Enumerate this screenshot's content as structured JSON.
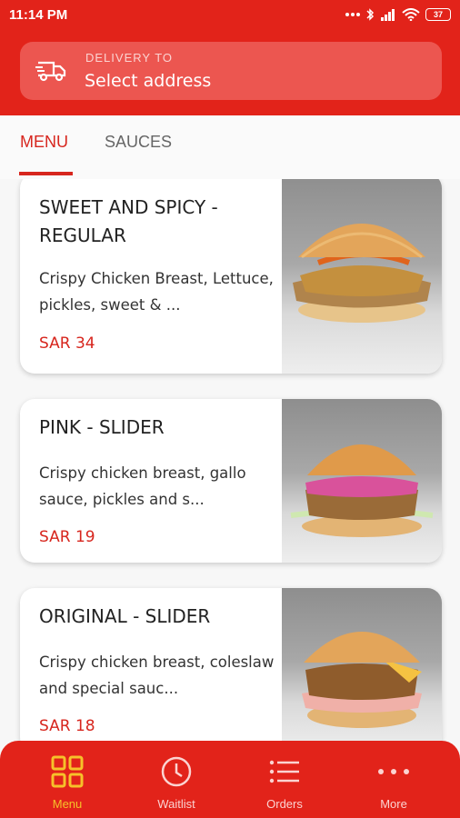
{
  "status_bar": {
    "time": "11:14 PM",
    "battery": "37"
  },
  "delivery": {
    "label": "DELIVERY TO",
    "value": "Select address"
  },
  "tabs": [
    {
      "label": "MENU",
      "active": true
    },
    {
      "label": "SAUCES",
      "active": false
    }
  ],
  "items": [
    {
      "title": "SWEET AND SPICY - REGULAR",
      "description": "Crispy Chicken Breast, Lettuce, pickles, sweet & ...",
      "price": "SAR 34"
    },
    {
      "title": "PINK - SLIDER",
      "description": "Crispy chicken breast, gallo sauce, pickles and s...",
      "price": "SAR 19"
    },
    {
      "title": "ORIGINAL - SLIDER",
      "description": "Crispy chicken breast, coleslaw and special sauc...",
      "price": "SAR 18"
    }
  ],
  "bottom_nav": [
    {
      "label": "Menu",
      "icon": "grid-icon",
      "active": true
    },
    {
      "label": "Waitlist",
      "icon": "clock-icon",
      "active": false
    },
    {
      "label": "Orders",
      "icon": "list-icon",
      "active": false
    },
    {
      "label": "More",
      "icon": "more-dots-icon",
      "active": false
    }
  ],
  "colors": {
    "brand_red": "#e2231a",
    "price_red": "#d7261e",
    "active_nav": "#f6c12a"
  }
}
